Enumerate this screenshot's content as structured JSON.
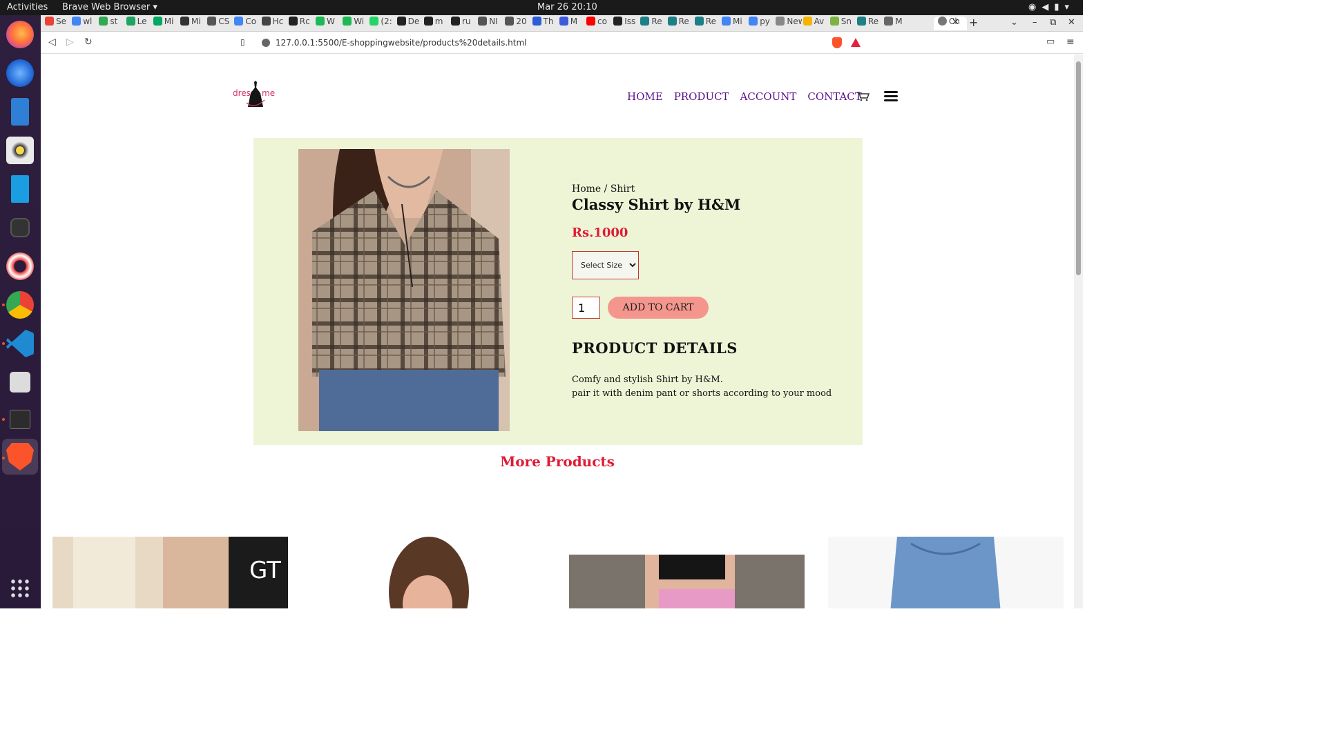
{
  "system": {
    "activities": "Activities",
    "app_menu": "Brave Web Browser ▾",
    "clock": "Mar 26  20:10"
  },
  "browser": {
    "tabs": [
      "Se",
      "wl",
      "st",
      "Le",
      "Mi",
      "Mi",
      "CS",
      "Co",
      "Hc",
      "Rc",
      "W",
      "Wi",
      "(2:",
      "De",
      "m",
      "ru",
      "NI",
      "20",
      "Th",
      "M",
      "co",
      "Iss",
      "Re",
      "Re",
      "Re",
      "Mi",
      "py",
      "New T",
      "Av",
      "Sn",
      "Re",
      "M",
      "Ch"
    ],
    "url": "127.0.0.1:5500/E-shoppingwebsite/products%20details.html"
  },
  "site": {
    "logo_text": "dress me",
    "nav": [
      "HOME",
      "PRODUCT",
      "ACCOUNT",
      "CONTACT"
    ]
  },
  "product": {
    "breadcrumb": "Home / Shirt",
    "title": "Classy Shirt by H&M",
    "price": "Rs.1000",
    "size_placeholder": "Select Size",
    "quantity": "1",
    "add_to_cart": "ADD TO CART",
    "details_heading": "PRODUCT DETAILS",
    "details_line1": "Comfy and stylish Shirt by H&M.",
    "details_line2": "pair it with denim pant or shorts according to your mood"
  },
  "more": {
    "title": "More Products"
  },
  "colors": {
    "nav": "#5a0f8c",
    "price": "#e01b35",
    "panel": "#eef5d6",
    "button": "#f5968e"
  }
}
